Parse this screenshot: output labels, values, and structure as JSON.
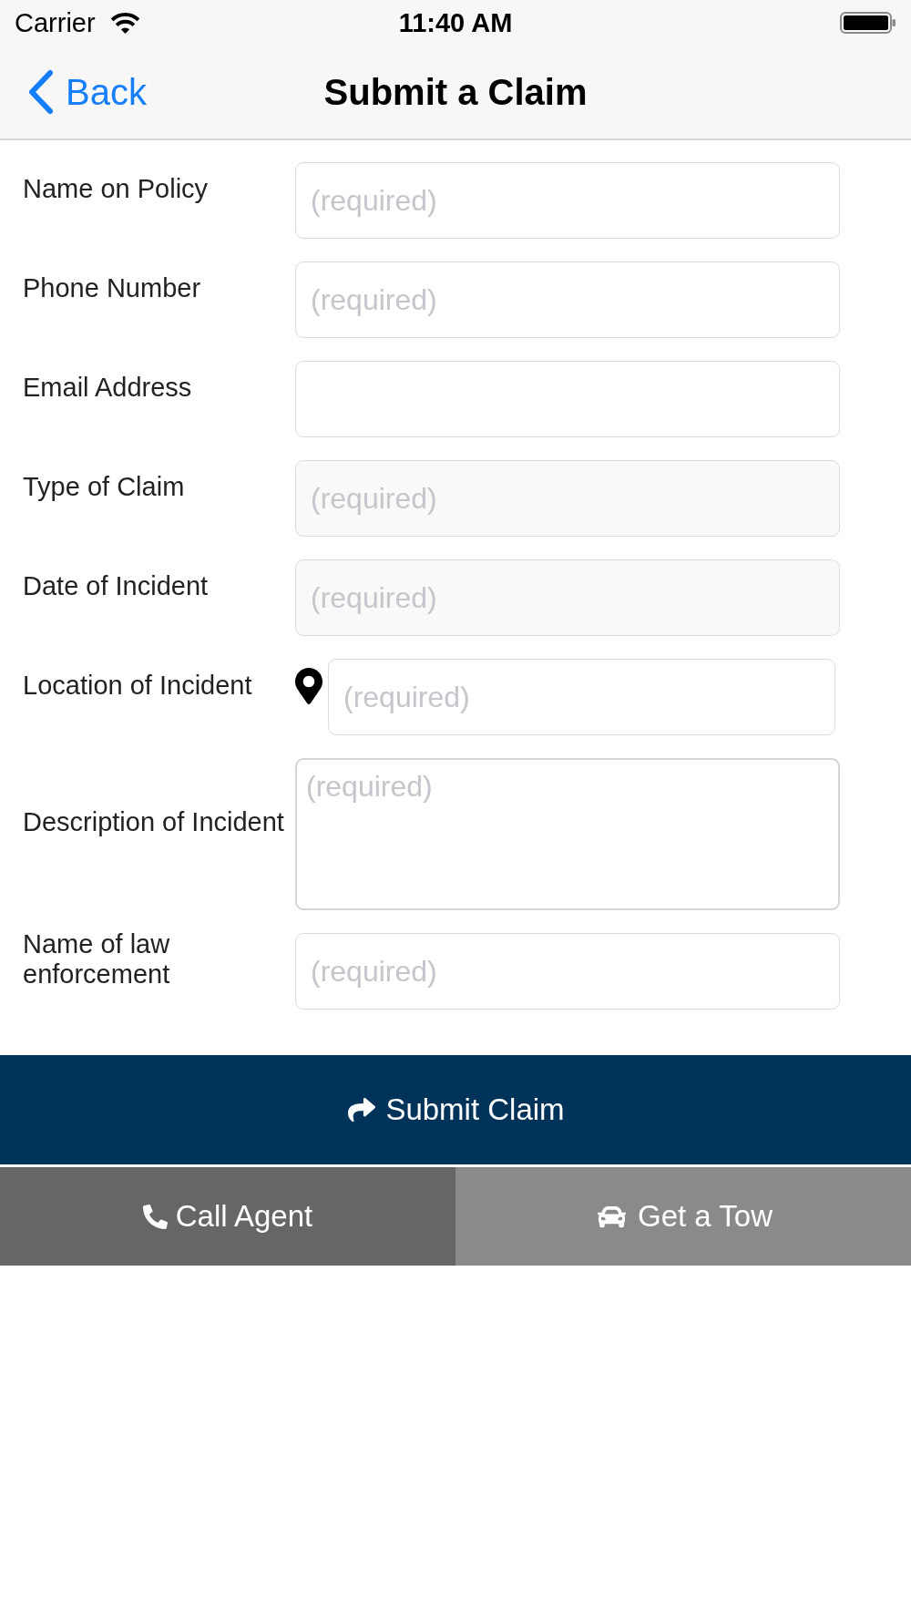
{
  "status_bar": {
    "carrier": "Carrier",
    "time": "11:40 AM"
  },
  "nav_bar": {
    "back": "Back",
    "title": "Submit a Claim"
  },
  "form": {
    "fields": [
      {
        "kind": "text",
        "label": "Name on Policy",
        "placeholder": "(required)"
      },
      {
        "kind": "text",
        "label": "Phone Number",
        "placeholder": "(required)"
      },
      {
        "kind": "text",
        "label": "Email Address"
      },
      {
        "kind": "picker",
        "label": "Type of Claim",
        "placeholder": "(required)"
      },
      {
        "kind": "picker",
        "label": "Date of Incident",
        "placeholder": "(required)"
      },
      {
        "kind": "location",
        "label": "Location of Incident",
        "placeholder": "(required)"
      },
      {
        "kind": "textarea",
        "label": "Description of Incident",
        "placeholder": "(required)"
      },
      {
        "kind": "text",
        "label": "Name of law enforcement",
        "placeholder": "(required)"
      }
    ]
  },
  "submit_button": {
    "label": "Submit Claim"
  },
  "bottom_buttons": [
    {
      "kind": "call",
      "label": "Call Agent"
    },
    {
      "kind": "tow",
      "label": "Get a Tow"
    }
  ]
}
